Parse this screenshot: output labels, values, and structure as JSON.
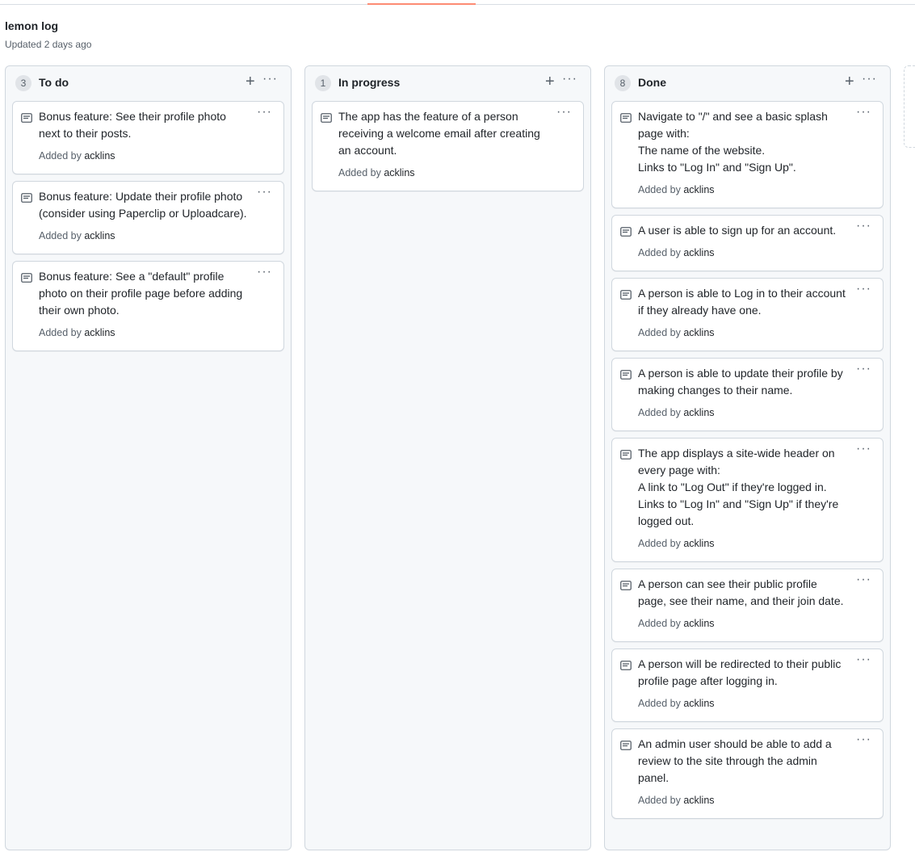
{
  "project": {
    "title": "lemon log",
    "updated": "Updated 2 days ago"
  },
  "columns": [
    {
      "count": "3",
      "title": "To do",
      "cards": [
        {
          "lines": [
            "Bonus feature: See their profile photo",
            "next to their posts."
          ],
          "added_label": "Added by",
          "author": "acklins"
        },
        {
          "lines": [
            "Bonus feature: Update their profile photo",
            "(consider using Paperclip or Uploadcare)."
          ],
          "added_label": "Added by",
          "author": "acklins"
        },
        {
          "lines": [
            "Bonus feature: See a \"default\" profile",
            "photo on their profile page before adding",
            "their own photo."
          ],
          "added_label": "Added by",
          "author": "acklins"
        }
      ]
    },
    {
      "count": "1",
      "title": "In progress",
      "cards": [
        {
          "lines": [
            "The app has the feature of a person",
            "receiving a welcome email after creating",
            "an account."
          ],
          "added_label": "Added by",
          "author": "acklins"
        }
      ]
    },
    {
      "count": "8",
      "title": "Done",
      "cards": [
        {
          "lines": [
            "Navigate to \"/\" and see a basic splash",
            "page with:",
            "The name of the website.",
            "Links to \"Log In\" and \"Sign Up\"."
          ],
          "added_label": "Added by",
          "author": "acklins"
        },
        {
          "lines": [
            "A user is able to sign up for an account."
          ],
          "added_label": "Added by",
          "author": "acklins"
        },
        {
          "lines": [
            "A person is able to Log in to their account",
            "if they already have one."
          ],
          "added_label": "Added by",
          "author": "acklins"
        },
        {
          "lines": [
            "A person is able to update their profile by",
            "making changes to their name."
          ],
          "added_label": "Added by",
          "author": "acklins"
        },
        {
          "lines": [
            "The app displays a site-wide header on",
            "every page with:",
            "A link to \"Log Out\" if they're logged in.",
            "Links to \"Log In\" and \"Sign Up\" if they're",
            "logged out."
          ],
          "added_label": "Added by",
          "author": "acklins"
        },
        {
          "lines": [
            "A person can see their public profile",
            "page, see their name, and their join date."
          ],
          "added_label": "Added by",
          "author": "acklins"
        },
        {
          "lines": [
            "A person will be redirected to their public",
            "profile page after logging in."
          ],
          "added_label": "Added by",
          "author": "acklins"
        },
        {
          "lines": [
            "An admin user should be able to add a",
            "review to the site through the admin",
            "panel."
          ],
          "added_label": "Added by",
          "author": "acklins"
        }
      ]
    }
  ],
  "icons": {
    "add": "plus-icon",
    "menu": "kebab-horizontal-icon",
    "note": "note-icon"
  },
  "colors": {
    "accent_underline": "#fd8c73",
    "column_bg": "#f6f8fa",
    "border": "#d0d7de",
    "muted_text": "#57606a"
  }
}
